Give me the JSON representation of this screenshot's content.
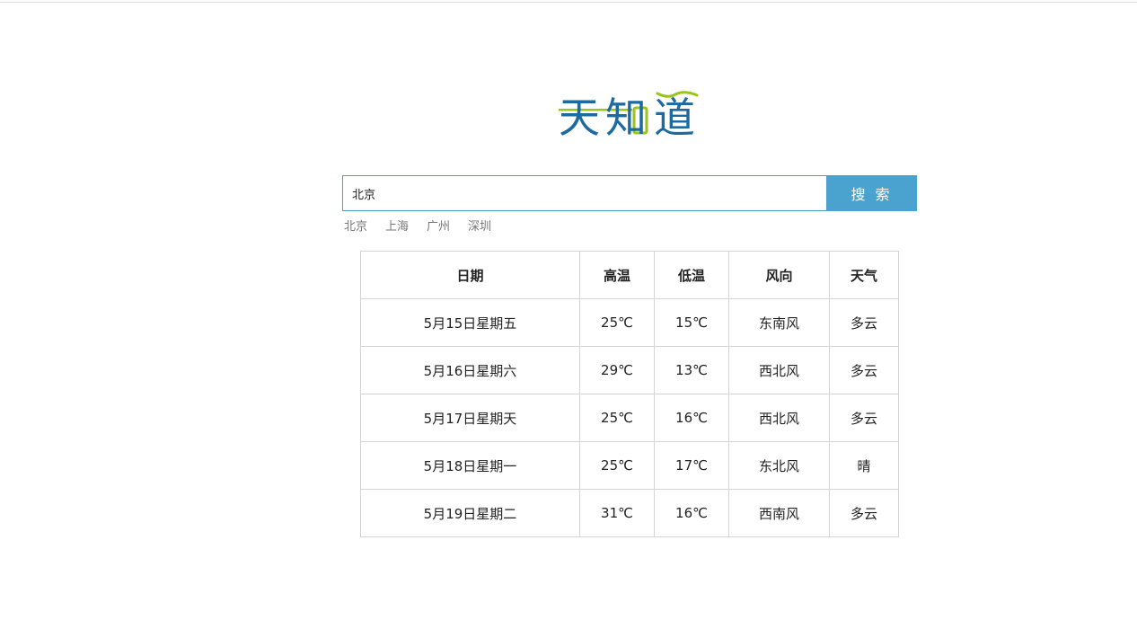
{
  "logo": {
    "text": "天知道",
    "chars": [
      "天",
      "知",
      "道"
    ],
    "colors": {
      "blue": "#1c6aa0",
      "green": "#9ac31c"
    }
  },
  "search": {
    "value": "北京",
    "placeholder": "",
    "button_label": "搜 索"
  },
  "quick_links": [
    "北京",
    "上海",
    "广州",
    "深圳"
  ],
  "table": {
    "headers": [
      "日期",
      "高温",
      "低温",
      "风向",
      "天气"
    ],
    "rows": [
      [
        "5月15日星期五",
        "25℃",
        "15℃",
        "东南风",
        "多云"
      ],
      [
        "5月16日星期六",
        "29℃",
        "13℃",
        "西北风",
        "多云"
      ],
      [
        "5月17日星期天",
        "25℃",
        "16℃",
        "西北风",
        "多云"
      ],
      [
        "5月18日星期一",
        "25℃",
        "17℃",
        "东北风",
        "晴"
      ],
      [
        "5月19日星期二",
        "31℃",
        "16℃",
        "西南风",
        "多云"
      ]
    ]
  },
  "theme": {
    "accent": "#4aa3cf",
    "border": "#d4d4d4",
    "link_gray": "#777777"
  }
}
